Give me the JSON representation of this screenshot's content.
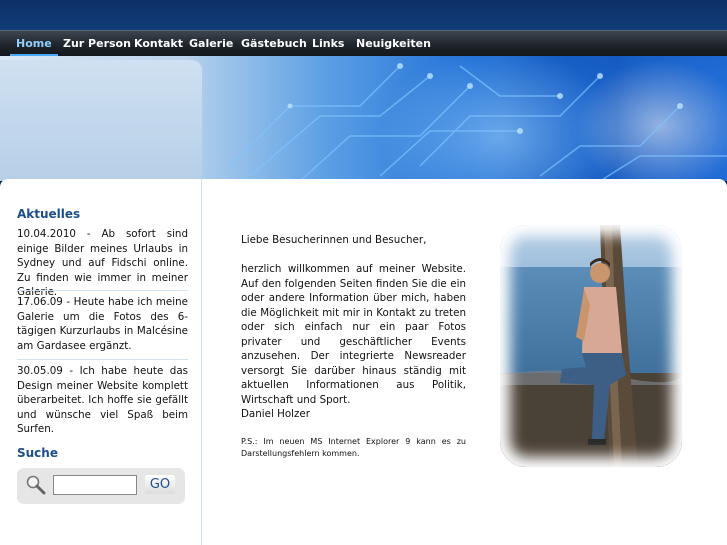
{
  "nav": {
    "items": [
      {
        "label": "Home",
        "active": true
      },
      {
        "label": "Zur Person",
        "active": false
      },
      {
        "label": "Kontakt",
        "active": false
      },
      {
        "label": "Galerie",
        "active": false
      },
      {
        "label": "Gästebuch",
        "active": false
      },
      {
        "label": "Links",
        "active": false
      },
      {
        "label": "Neuigkeiten",
        "active": false
      }
    ]
  },
  "sidebar": {
    "news_heading": "Aktuelles",
    "news": [
      "10.04.2010 - Ab sofort sind einige Bilder meines Urlaubs in Sydney und auf Fidschi online. Zu finden wie immer in meiner Galerie.",
      "17.06.09 - Heute habe ich meine Galerie um die Fotos des 6-tägigen Kurzurlaubs in Malcésine am Gardasee ergänzt.",
      "30.05.09 - Ich habe heute das Design meiner Website komplett überarbeitet. Ich hoffe sie gefällt und wünsche viel Spaß beim Surfen."
    ],
    "search_heading": "Suche",
    "search_value": "",
    "search_button": "GO",
    "search_icon": "magnifier-icon"
  },
  "main": {
    "greeting": "Liebe Besucherinnen und Besucher,",
    "body": "herzlich willkommen auf meiner Website. Auf den folgenden Seiten finden Sie die ein oder andere Information über mich, haben die Möglichkeit mit mir in Kontakt zu treten oder sich einfach nur ein paar Fotos privater und geschäftlicher Events anzusehen. Der integrierte Newsreader versorgt Sie darüber hinaus ständig mit aktuellen Informationen aus Politik, Wirtschaft und Sport.",
    "signature": "Daniel Holzer",
    "ps": "P.S.: Im neuen MS Internet Explorer 9 kann es zu Darstellungsfehlern kommen."
  },
  "colors": {
    "accent": "#1b4f8c",
    "nav_active": "#8fd0ff",
    "divider": "#d3e3f2"
  }
}
